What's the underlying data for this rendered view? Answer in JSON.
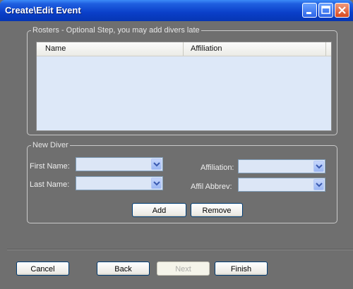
{
  "window": {
    "title": "Create\\Edit Event"
  },
  "rosters": {
    "legend": "Rosters - Optional Step, you may add divers late",
    "columns": [
      "Name",
      "Affiliation"
    ]
  },
  "new_diver": {
    "legend": "New Diver",
    "first_name_label": "First Name:",
    "last_name_label": "Last Name:",
    "affiliation_label": "Affiliation:",
    "affil_abbrev_label": "Affil Abbrev:",
    "first_name_value": "",
    "last_name_value": "",
    "affiliation_value": "",
    "affil_abbrev_value": "",
    "add_label": "Add",
    "remove_label": "Remove"
  },
  "footer": {
    "cancel_label": "Cancel",
    "back_label": "Back",
    "next_label": "Next",
    "finish_label": "Finish"
  },
  "icons": {
    "minimize": "minimize-icon",
    "maximize": "maximize-icon",
    "close": "close-icon",
    "dropdown": "chevron-down-icon"
  },
  "colors": {
    "titlebar": "#0a3fc9",
    "window_body": "#6f6f6f",
    "list_background": "#dde8f8",
    "button_border": "#003c74"
  }
}
